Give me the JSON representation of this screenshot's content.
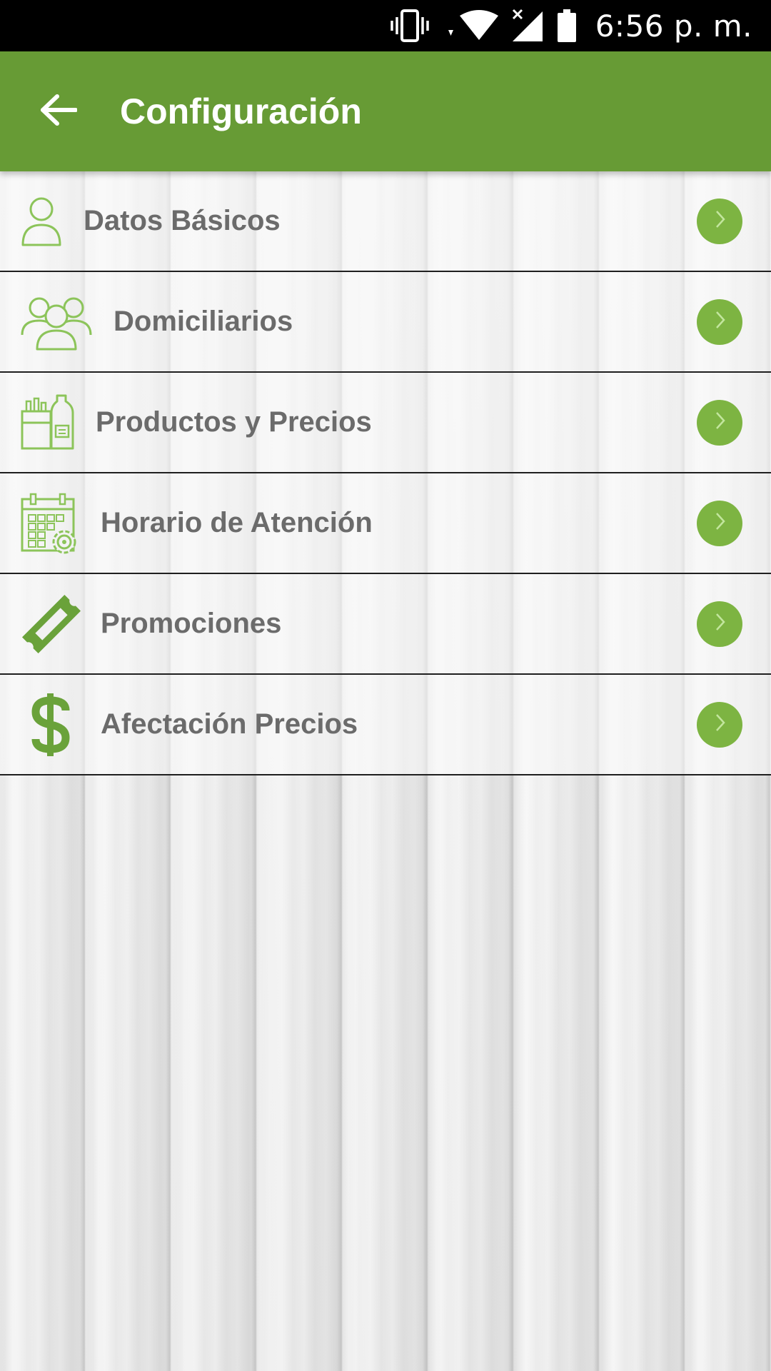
{
  "status_bar": {
    "time": "6:56 p. m.",
    "icons": [
      "vibrate-icon",
      "wifi-icon",
      "signal-icon",
      "battery-icon"
    ]
  },
  "app_bar": {
    "title": "Configuración",
    "back_icon": "arrow-left-icon"
  },
  "colors": {
    "primary": "#679b35",
    "icon_green": "#7db442",
    "text_gray": "#6b6b6b"
  },
  "menu": {
    "items": [
      {
        "label": "Datos Básicos",
        "icon": "user-icon"
      },
      {
        "label": "Domiciliarios",
        "icon": "group-icon"
      },
      {
        "label": "Productos y Precios",
        "icon": "products-icon"
      },
      {
        "label": "Horario de Atención",
        "icon": "calendar-gear-icon"
      },
      {
        "label": "Promociones",
        "icon": "ticket-icon"
      },
      {
        "label": "Afectación Precios",
        "icon": "dollar-icon"
      }
    ]
  }
}
